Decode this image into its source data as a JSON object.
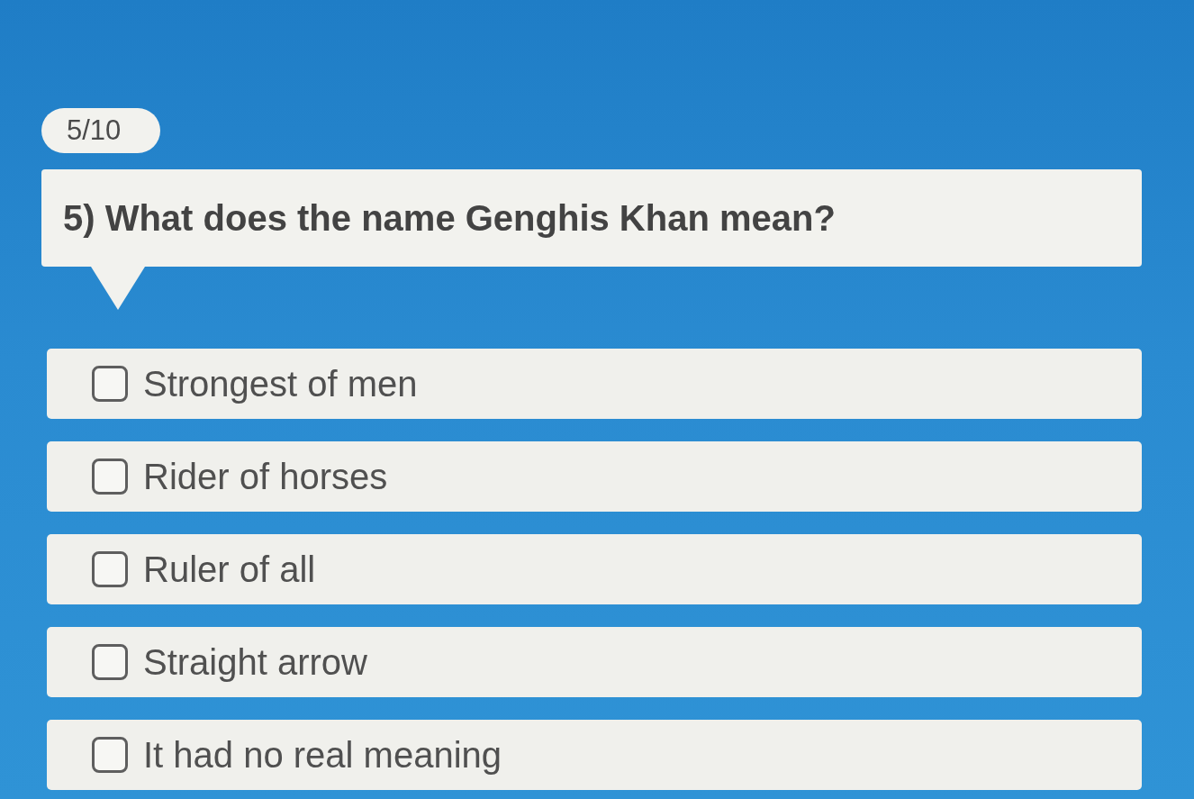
{
  "progress": "5/10",
  "question": "5) What does the name Genghis Khan mean?",
  "options": [
    {
      "label": "Strongest of men",
      "checked": false
    },
    {
      "label": "Rider of horses",
      "checked": false
    },
    {
      "label": "Ruler of all",
      "checked": false
    },
    {
      "label": "Straight arrow",
      "checked": false
    },
    {
      "label": "It had no real meaning",
      "checked": false
    }
  ]
}
